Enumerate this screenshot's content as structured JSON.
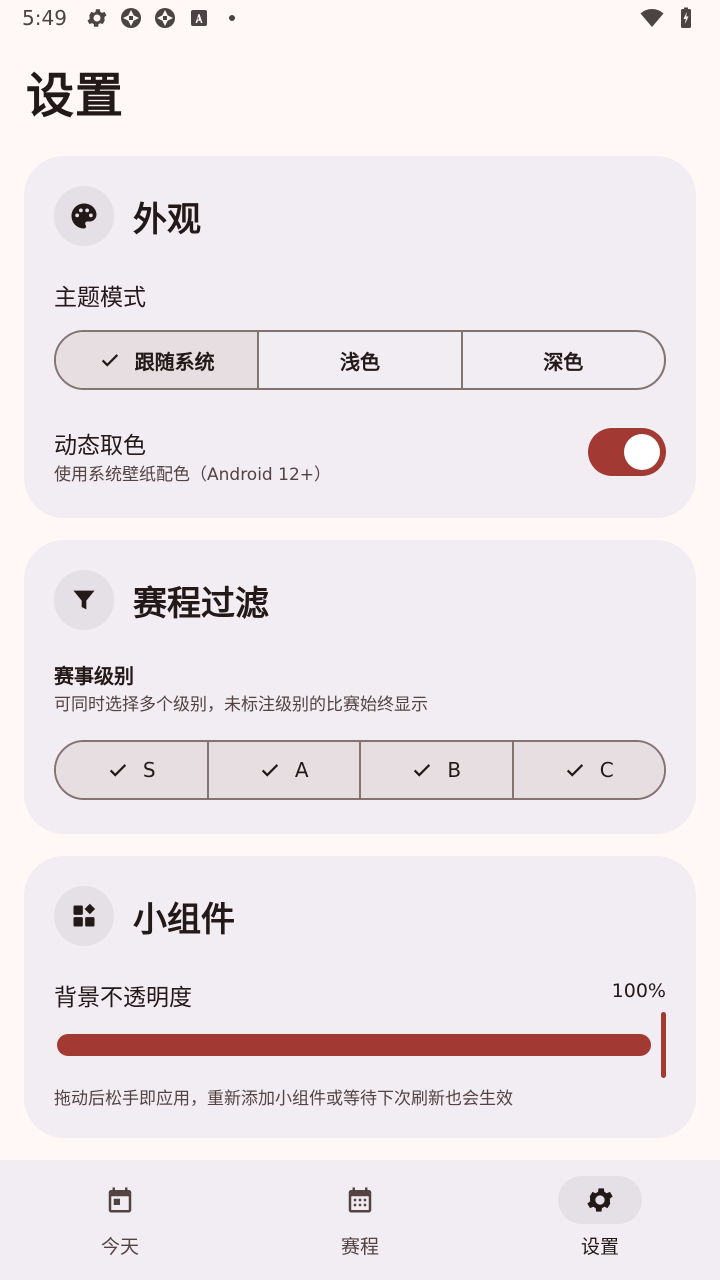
{
  "status_bar": {
    "time": "5:49",
    "left_icons": [
      "gear-icon",
      "aperture-icon",
      "aperture-icon",
      "text-a-icon",
      "dot-icon"
    ],
    "right_icons": [
      "wifi-icon",
      "battery-charging-icon"
    ]
  },
  "page": {
    "title": "设置"
  },
  "appearance": {
    "title": "外观",
    "icon": "palette-icon",
    "theme_label": "主题模式",
    "theme_options": [
      {
        "label": "跟随系统",
        "selected": true
      },
      {
        "label": "浅色",
        "selected": false
      },
      {
        "label": "深色",
        "selected": false
      }
    ],
    "dynamic_color_label": "动态取色",
    "dynamic_color_desc": "使用系统壁纸配色（Android 12+）",
    "dynamic_color_on": true
  },
  "filter": {
    "title": "赛程过滤",
    "icon": "filter-icon",
    "level_label": "赛事级别",
    "level_desc": "可同时选择多个级别，未标注级别的比赛始终显示",
    "levels": [
      {
        "label": "S",
        "selected": true
      },
      {
        "label": "A",
        "selected": true
      },
      {
        "label": "B",
        "selected": true
      },
      {
        "label": "C",
        "selected": true
      }
    ]
  },
  "widget": {
    "title": "小组件",
    "icon": "widgets-icon",
    "opacity_label": "背景不透明度",
    "opacity_value": "100%",
    "opacity_fraction": 1.0,
    "hint": "拖动后松手即应用，重新添加小组件或等待下次刷新也会生效"
  },
  "bottom_nav": {
    "items": [
      {
        "label": "今天",
        "icon": "calendar-today-icon",
        "active": false
      },
      {
        "label": "赛程",
        "icon": "calendar-month-icon",
        "active": false
      },
      {
        "label": "设置",
        "icon": "gear-icon",
        "active": true
      }
    ]
  },
  "colors": {
    "accent": "#a23a33",
    "card_bg": "#f2ecf3",
    "page_bg": "#fff8f6",
    "outline": "#857371"
  }
}
